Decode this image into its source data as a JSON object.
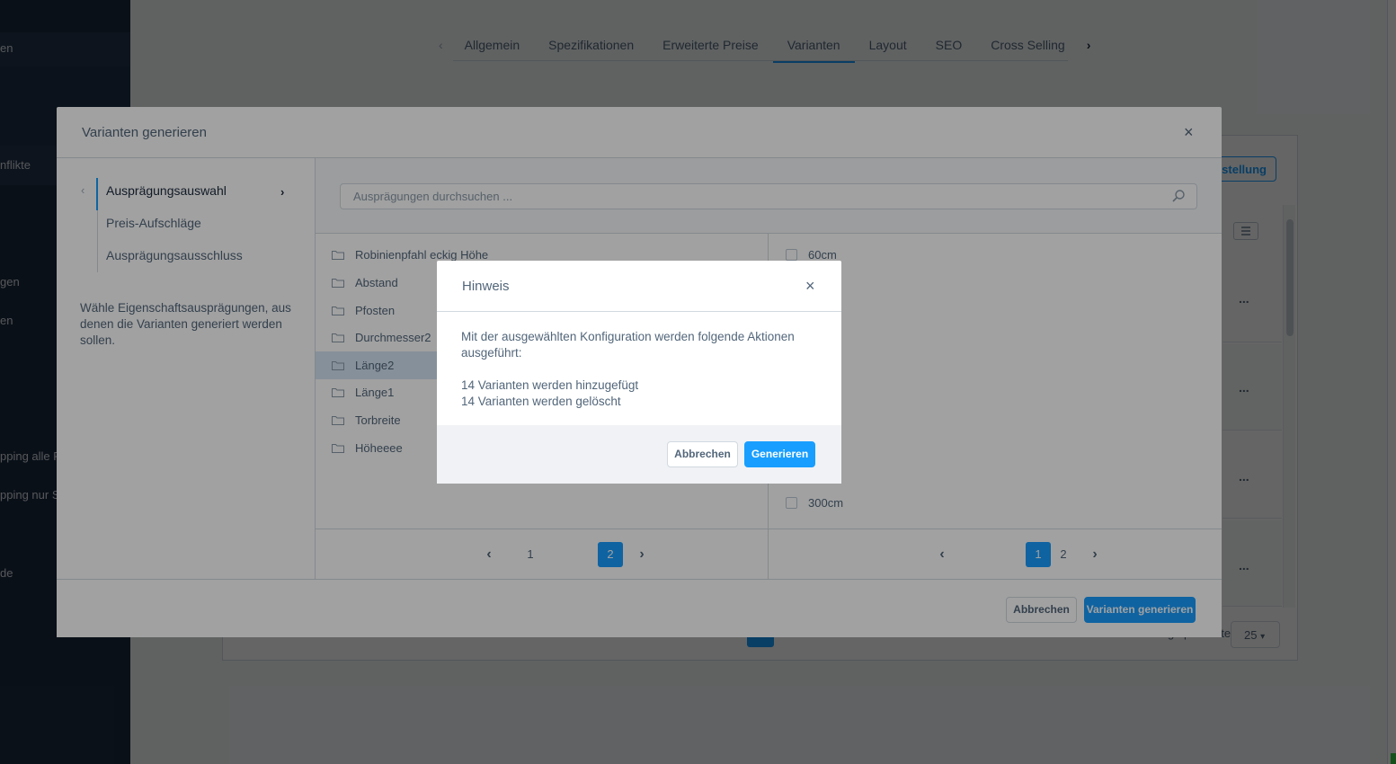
{
  "background": {
    "sidebar": {
      "items": [
        {
          "label": "en"
        },
        {
          "label": "nflikte"
        },
        {
          "label": "gen"
        },
        {
          "label": "en"
        },
        {
          "label": "pping alle Pr"
        },
        {
          "label": "pping nur St"
        },
        {
          "label": "de"
        }
      ]
    },
    "tabs": [
      "Allgemein",
      "Spezifikationen",
      "Erweiterte Preise",
      "Varianten",
      "Layout",
      "SEO",
      "Cross Selling"
    ],
    "active_tab": "Varianten",
    "card_button_label": "stellung",
    "row_menu_label": "...",
    "per_page_label": "Einträge pro Seite:",
    "per_page_value": "25"
  },
  "modal": {
    "title": "Varianten generieren",
    "close_icon": "×",
    "nav": {
      "items": [
        "Ausprägungsauswahl",
        "Preis-Aufschläge",
        "Ausprägungsausschluss"
      ],
      "active": "Ausprägungsauswahl"
    },
    "description": "Wähle Eigenschaftsausprägungen, aus denen die Varianten generiert werden sollen.",
    "search": {
      "placeholder": "Ausprägungen durchsuchen ..."
    },
    "groups": [
      "Robinienpfahl eckig Höhe",
      "Abstand",
      "Pfosten",
      "Durchmesser2",
      "Länge2",
      "Länge1",
      "Torbreite",
      "Höheeee"
    ],
    "selected_group": "Länge2",
    "options": [
      "60cm",
      "300cm"
    ],
    "left_pager": {
      "pages": [
        "1",
        "2"
      ],
      "active": "2"
    },
    "right_pager": {
      "pages": [
        "1",
        "2"
      ],
      "active": "1"
    },
    "footer": {
      "cancel_label": "Abbrechen",
      "generate_label": "Varianten generieren"
    }
  },
  "hint": {
    "title": "Hinweis",
    "close_icon": "×",
    "intro": "Mit der ausgewählten Konfiguration werden folgende Aktionen ausgeführt:",
    "actions": [
      "14 Varianten werden hinzugefügt",
      "14 Varianten werden gelöscht"
    ],
    "cancel_label": "Abbrechen",
    "confirm_label": "Generieren"
  },
  "colors": {
    "primary": "#189eff",
    "sidebar": "#1b2a3d",
    "text": "#52667a",
    "selected_row": "#d4e5f4"
  }
}
